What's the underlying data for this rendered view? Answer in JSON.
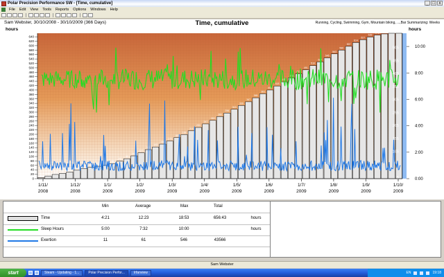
{
  "window": {
    "title": "Polar Precision Performance SW - [Time, cumulative]",
    "buttons": [
      "_",
      "□",
      "x"
    ]
  },
  "menu": [
    "File",
    "Edit",
    "View",
    "Tools",
    "Reports",
    "Options",
    "Windows",
    "Help"
  ],
  "toolbar": {
    "icons": [
      "new-icon",
      "open-icon",
      "save-icon",
      "print-icon",
      "diary-icon",
      "week-icon",
      "month-icon",
      "year-icon",
      "exercise-icon",
      "report-icon",
      "tests-icon",
      "chart-icon",
      "settings-icon",
      "help-icon"
    ]
  },
  "chart_header": {
    "subtitle": "Sam Webster, 30/10/2008 - 30/10/2009 (366 Days)",
    "title": "Time, cumulative",
    "right_note": "Running, Cycling, Swimming, Gym, Mountain biking, ...,Bar Summarizing: Weeks",
    "left_unit": "hours",
    "right_unit": "hours"
  },
  "chart_data": {
    "type": "bar",
    "title": "Time, cumulative",
    "x_tick_labels": [
      [
        "1/11/",
        "2008"
      ],
      [
        "1/12/",
        "2008"
      ],
      [
        "1/1/",
        "2009"
      ],
      [
        "1/2/",
        "2009"
      ],
      [
        "1/3/",
        "2009"
      ],
      [
        "1/4/",
        "2009"
      ],
      [
        "1/5/",
        "2009"
      ],
      [
        "1/6/",
        "2009"
      ],
      [
        "1/7/",
        "2009"
      ],
      [
        "1/8/",
        "2009"
      ],
      [
        "1/9/",
        "2009"
      ],
      [
        "1/10/",
        "2009"
      ]
    ],
    "ylim": [
      0,
      656
    ],
    "y2_ticks": [
      "0:00",
      "2:00",
      "4:00",
      "6:00",
      "8:00",
      "10:00"
    ],
    "y2lim": [
      0,
      11
    ],
    "y3_ticks": [
      "5",
      "105",
      "155",
      "205",
      "255",
      "305",
      "355",
      "405",
      "455",
      "505"
    ],
    "weekly_cumulative_hours": [
      4,
      12,
      19,
      24,
      30,
      38,
      45,
      51,
      56,
      61,
      68,
      79,
      90,
      103,
      117,
      131,
      143,
      156,
      170,
      185,
      199,
      216,
      231,
      247,
      263,
      280,
      296,
      313,
      330,
      347,
      365,
      383,
      400,
      418,
      437,
      455,
      473,
      491,
      510,
      527,
      545,
      563,
      580,
      597,
      614,
      627,
      639,
      648,
      653,
      656,
      656
    ],
    "series": [
      {
        "name": "Time",
        "color": "#e0e0e0"
      },
      {
        "name": "Sleep Hours",
        "color": "#22dd22",
        "typical_value": "7:32"
      },
      {
        "name": "Exertion",
        "color": "#1f78e6",
        "typical_value": "61"
      }
    ],
    "background": "gradient-orange-to-white",
    "grid": true
  },
  "legend": {
    "headers": [
      "Min",
      "Average",
      "Max",
      "Total"
    ],
    "rows": [
      {
        "name": "Time",
        "min": "4:21",
        "avg": "12:23",
        "max": "18:53",
        "total": "656:43",
        "unit": "hours"
      },
      {
        "name": "Sleep Hours",
        "min": "5:00",
        "avg": "7:32",
        "max": "10:00",
        "total": "",
        "unit": "hours"
      },
      {
        "name": "Exertion",
        "min": "11",
        "avg": "61",
        "max": "546",
        "total": "43566",
        "unit": ""
      }
    ]
  },
  "status": {
    "user": "Sam Webster"
  },
  "taskbar": {
    "start": "start",
    "tasks": [
      "Steam - Updating - 1...",
      "Polar Precision Perfor...",
      "Irfanview"
    ],
    "tray_lang": "EN",
    "clock": "19:18"
  }
}
